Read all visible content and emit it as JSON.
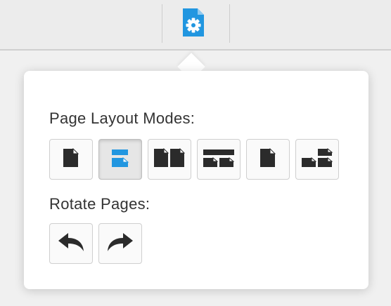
{
  "colors": {
    "accent": "#2196e0",
    "icon_dark": "#2b2b2b",
    "toolbar_bg": "#ececec",
    "popup_bg": "#ffffff"
  },
  "toolbar": {
    "settings_icon": "document-gear-icon"
  },
  "popup": {
    "layout_label": "Page Layout Modes:",
    "rotate_label": "Rotate Pages:",
    "layout_modes": [
      {
        "icon": "single-page-icon",
        "selected": false
      },
      {
        "icon": "continuous-page-icon",
        "selected": true
      },
      {
        "icon": "facing-pages-icon",
        "selected": false
      },
      {
        "icon": "facing-continuous-icon",
        "selected": false
      },
      {
        "icon": "cover-page-icon",
        "selected": false
      },
      {
        "icon": "cover-continuous-icon",
        "selected": false
      }
    ],
    "rotate_buttons": [
      {
        "icon": "rotate-counterclockwise-icon"
      },
      {
        "icon": "rotate-clockwise-icon"
      }
    ]
  }
}
